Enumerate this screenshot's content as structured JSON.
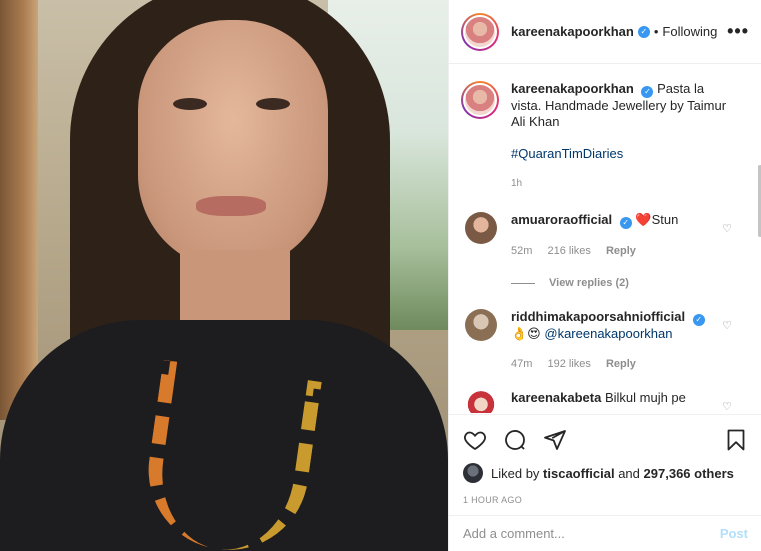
{
  "header": {
    "username": "kareenakapoorkhan",
    "separator": "•",
    "follow_status": "Following",
    "more": "•••"
  },
  "caption": {
    "username": "kareenakapoorkhan",
    "text": "Pasta la vista. Handmade Jewellery by Taimur Ali Khan",
    "hashtag": "#QuaranTimDiaries",
    "time": "1h"
  },
  "comments": [
    {
      "username": "amuaroraofficial",
      "emoji": "❤️",
      "text": "Stun",
      "time": "52m",
      "likes": "216 likes",
      "reply": "Reply"
    },
    {
      "username": "riddhimakapoorsahniofficial",
      "emoji": "👌😍",
      "mention": "@kareenakapoorkhan",
      "time": "47m",
      "likes": "192 likes",
      "reply": "Reply"
    },
    {
      "username": "kareenakabeta",
      "text": "Bilkul mujh pe"
    }
  ],
  "view_replies": "View replies (2)",
  "likes": {
    "prefix": "Liked by",
    "user": "tiscaofficial",
    "middle": "and",
    "count": "297,366 others"
  },
  "posted_ago": "1 HOUR AGO",
  "add_comment": {
    "placeholder": "Add a comment...",
    "post_label": "Post"
  },
  "icons": {
    "verified": "verified-icon",
    "like": "heart-icon",
    "comment": "comment-icon",
    "share": "share-icon",
    "save": "bookmark-icon"
  }
}
